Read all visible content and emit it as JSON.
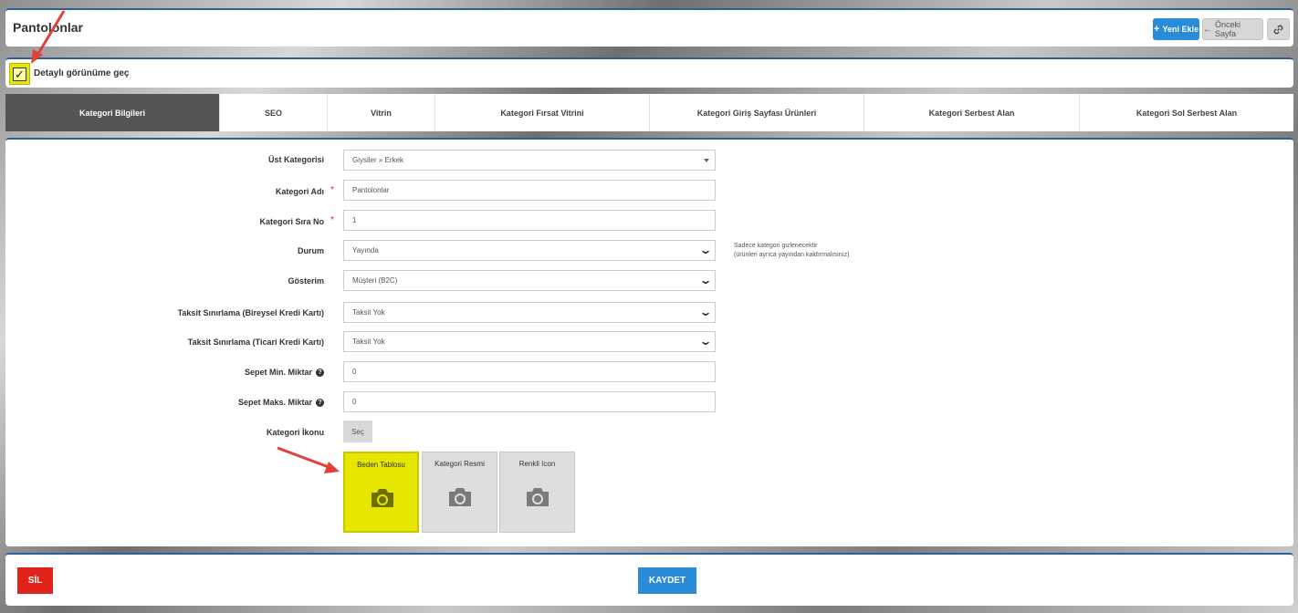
{
  "header": {
    "title": "Pantolonlar",
    "new_label": "Yeni Ekle",
    "prev_label": "Önceki Sayfa"
  },
  "detail_toggle": {
    "label": "Detaylı görünüme geç",
    "checked": true
  },
  "tabs": [
    {
      "label": "Kategori Bilgileri",
      "active": true
    },
    {
      "label": "SEO",
      "active": false
    },
    {
      "label": "Vitrin",
      "active": false
    },
    {
      "label": "Kategori Fırsat Vitrini",
      "active": false
    },
    {
      "label": "Kategori Giriş Sayfası Ürünleri",
      "active": false
    },
    {
      "label": "Kategori Serbest Alan",
      "active": false
    },
    {
      "label": "Kategori Sol Serbest Alan",
      "active": false
    }
  ],
  "form": {
    "parent_category": {
      "label": "Üst Kategorisi",
      "value": "Giysiler » Erkek"
    },
    "category_name": {
      "label": "Kategori Adı",
      "value": "Pantolonlar",
      "required_mark": "*"
    },
    "sort_no": {
      "label": "Kategori Sıra No",
      "value": "1",
      "required_mark": "*"
    },
    "status": {
      "label": "Durum",
      "value": "Yayında"
    },
    "display": {
      "label": "Gösterim",
      "value": "Müşteri (B2C)"
    },
    "installment_personal": {
      "label": "Taksit Sınırlama (Bireysel Kredi Kartı)",
      "value": "Taksit Yok"
    },
    "installment_commercial": {
      "label": "Taksit Sınırlama (Ticari Kredi Kartı)",
      "value": "Taksit Yok"
    },
    "cart_min": {
      "label": "Sepet Min. Miktar",
      "value": "0"
    },
    "cart_max": {
      "label": "Sepet Maks. Miktar",
      "value": "0"
    },
    "category_icon": {
      "label": "Kategori İkonu",
      "button_label": "Seç"
    },
    "status_note_line1": "Sadece kategori gizlenecektir",
    "status_note_line2": "(ürünleri ayrıca yayından kaldırmalısınız)",
    "images": [
      {
        "label": "Beden Tablosu",
        "highlighted": true
      },
      {
        "label": "Kategori Resmi",
        "highlighted": false
      },
      {
        "label": "Renkli Icon",
        "highlighted": false
      }
    ]
  },
  "footer": {
    "delete_label": "SİL",
    "save_label": "KAYDET"
  },
  "colors": {
    "highlight": "#e6e600",
    "primary": "#2a8bd8",
    "danger": "#e0241c",
    "active_tab": "#545454",
    "annotation_arrow": "#e0413a"
  }
}
